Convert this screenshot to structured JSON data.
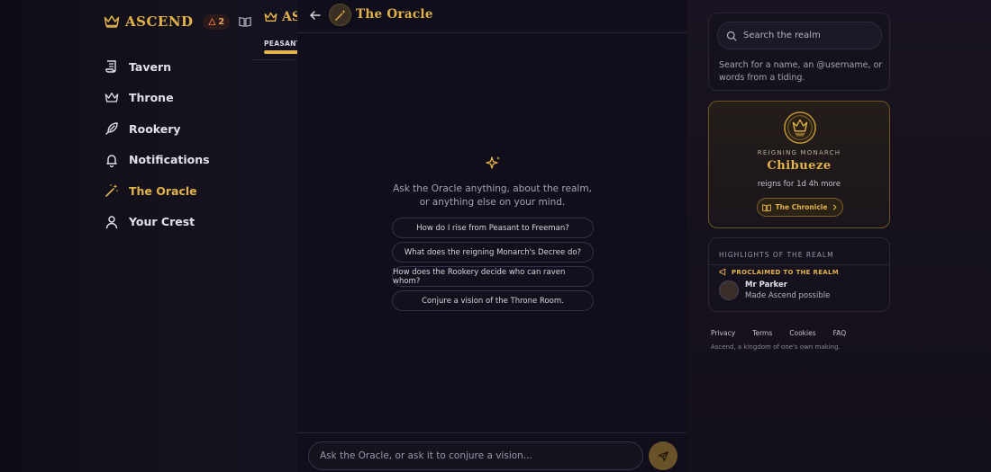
{
  "brand": {
    "name": "ASCEND",
    "streak": "2"
  },
  "nav": [
    {
      "label": "Tavern",
      "icon": "scroll-icon"
    },
    {
      "label": "Throne",
      "icon": "crown-icon"
    },
    {
      "label": "Rookery",
      "icon": "feather-icon"
    },
    {
      "label": "Notifications",
      "icon": "bell-icon"
    },
    {
      "label": "The Oracle",
      "icon": "wand-icon",
      "active": true
    },
    {
      "label": "Your Crest",
      "icon": "user-icon"
    }
  ],
  "background_page": {
    "title": "AS",
    "tab": "PEASANT"
  },
  "oracle": {
    "title": "The Oracle",
    "intro": "Ask the Oracle anything, about the realm, or anything else on your mind.",
    "suggestions": [
      "How do I rise from Peasant to Freeman?",
      "What does the reigning Monarch's Decree do?",
      "How does the Rookery decide who can raven whom?",
      "Conjure a vision of the Throne Room."
    ],
    "composer_placeholder": "Ask the Oracle, or ask it to conjure a vision..."
  },
  "search": {
    "placeholder": "Search the realm",
    "hint": "Search for a name, an @username, or words from a tiding."
  },
  "monarch": {
    "kicker": "REIGNING MONARCH",
    "name": "Chibueze",
    "reign": "reigns for 1d 4h more",
    "chronicle_label": "The Chronicle"
  },
  "highlights": {
    "heading": "HIGHLIGHTS OF THE REALM",
    "kicker": "PROCLAIMED TO THE REALM",
    "name": "Mr Parker",
    "text": "Made Ascend possible"
  },
  "footer": {
    "links": [
      "Privacy",
      "Terms",
      "Cookies",
      "FAQ"
    ],
    "tagline": "Ascend, a kingdom of one's own making."
  },
  "colors": {
    "gold": "#e2b34a",
    "background": "#100e1a",
    "text": "#e4e0ea"
  }
}
